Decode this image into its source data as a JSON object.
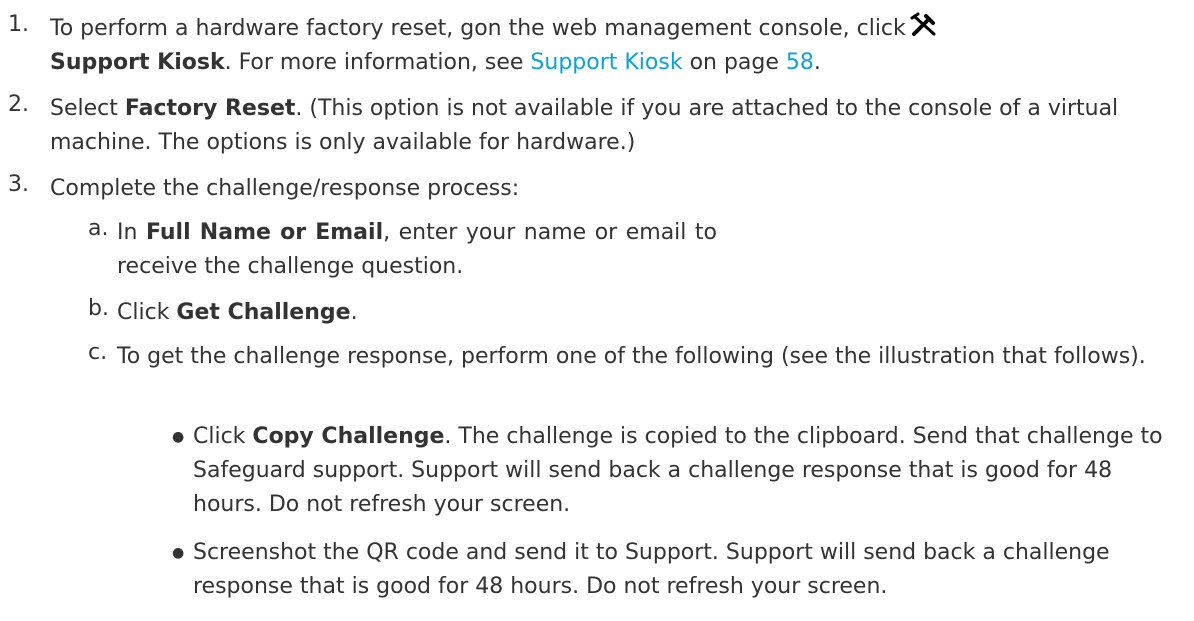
{
  "steps": [
    {
      "number": "1.",
      "text_before": "To perform a hardware factory reset, gon the web management console, click",
      "icon": "support-kiosk-tools-icon",
      "bold": "Support Kiosk",
      "text_mid": ". For more information, see ",
      "link": "Support Kiosk",
      "text_on_page": " on page ",
      "page_link": "58",
      "text_end": "."
    },
    {
      "number": "2.",
      "text_before": "Select ",
      "bold": "Factory Reset",
      "text_after": ". (This option is not available if you are attached to the console of a virtual machine. The options is only available for hardware.)"
    },
    {
      "number": "3.",
      "text": "Complete the challenge/response process:"
    }
  ],
  "substeps": [
    {
      "letter": "a.",
      "text_before": "In ",
      "bold": "Full Name or Email",
      "text_after": ", enter your name or email to receive the challenge question."
    },
    {
      "letter": "b.",
      "text_before": "Click ",
      "bold": "Get Challenge",
      "text_after": "."
    },
    {
      "letter": "c.",
      "text": "To get the challenge response, perform one of the following (see the illustration that follows)."
    }
  ],
  "bullets": [
    {
      "marker": "●",
      "text_before": "Click ",
      "bold": "Copy Challenge",
      "text_after": ". The challenge is copied to the clipboard. Send that challenge to Safeguard support. Support will send back a challenge response that is good for 48 hours. Do not refresh your screen."
    },
    {
      "marker": "●",
      "text": "Screenshot the QR code and send it to Support. Support will send back a challenge response that is good for 48 hours. Do not refresh your screen."
    }
  ],
  "colors": {
    "text": "#333333",
    "link": "#0aa3d9"
  }
}
